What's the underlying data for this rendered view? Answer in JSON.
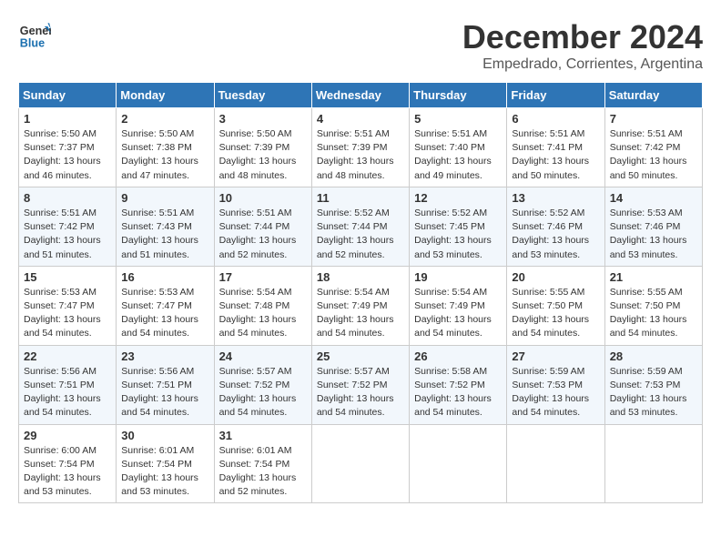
{
  "header": {
    "logo_line1": "General",
    "logo_line2": "Blue",
    "title": "December 2024",
    "subtitle": "Empedrado, Corrientes, Argentina"
  },
  "calendar": {
    "days_of_week": [
      "Sunday",
      "Monday",
      "Tuesday",
      "Wednesday",
      "Thursday",
      "Friday",
      "Saturday"
    ],
    "weeks": [
      [
        {
          "day": "",
          "detail": ""
        },
        {
          "day": "2",
          "detail": "Sunrise: 5:50 AM\nSunset: 7:38 PM\nDaylight: 13 hours\nand 47 minutes."
        },
        {
          "day": "3",
          "detail": "Sunrise: 5:50 AM\nSunset: 7:39 PM\nDaylight: 13 hours\nand 48 minutes."
        },
        {
          "day": "4",
          "detail": "Sunrise: 5:51 AM\nSunset: 7:39 PM\nDaylight: 13 hours\nand 48 minutes."
        },
        {
          "day": "5",
          "detail": "Sunrise: 5:51 AM\nSunset: 7:40 PM\nDaylight: 13 hours\nand 49 minutes."
        },
        {
          "day": "6",
          "detail": "Sunrise: 5:51 AM\nSunset: 7:41 PM\nDaylight: 13 hours\nand 50 minutes."
        },
        {
          "day": "7",
          "detail": "Sunrise: 5:51 AM\nSunset: 7:42 PM\nDaylight: 13 hours\nand 50 minutes."
        }
      ],
      [
        {
          "day": "1",
          "detail": "Sunrise: 5:50 AM\nSunset: 7:37 PM\nDaylight: 13 hours\nand 46 minutes."
        },
        {
          "day": "9",
          "detail": "Sunrise: 5:51 AM\nSunset: 7:43 PM\nDaylight: 13 hours\nand 51 minutes."
        },
        {
          "day": "10",
          "detail": "Sunrise: 5:51 AM\nSunset: 7:44 PM\nDaylight: 13 hours\nand 52 minutes."
        },
        {
          "day": "11",
          "detail": "Sunrise: 5:52 AM\nSunset: 7:44 PM\nDaylight: 13 hours\nand 52 minutes."
        },
        {
          "day": "12",
          "detail": "Sunrise: 5:52 AM\nSunset: 7:45 PM\nDaylight: 13 hours\nand 53 minutes."
        },
        {
          "day": "13",
          "detail": "Sunrise: 5:52 AM\nSunset: 7:46 PM\nDaylight: 13 hours\nand 53 minutes."
        },
        {
          "day": "14",
          "detail": "Sunrise: 5:53 AM\nSunset: 7:46 PM\nDaylight: 13 hours\nand 53 minutes."
        }
      ],
      [
        {
          "day": "8",
          "detail": "Sunrise: 5:51 AM\nSunset: 7:42 PM\nDaylight: 13 hours\nand 51 minutes."
        },
        {
          "day": "16",
          "detail": "Sunrise: 5:53 AM\nSunset: 7:47 PM\nDaylight: 13 hours\nand 54 minutes."
        },
        {
          "day": "17",
          "detail": "Sunrise: 5:54 AM\nSunset: 7:48 PM\nDaylight: 13 hours\nand 54 minutes."
        },
        {
          "day": "18",
          "detail": "Sunrise: 5:54 AM\nSunset: 7:49 PM\nDaylight: 13 hours\nand 54 minutes."
        },
        {
          "day": "19",
          "detail": "Sunrise: 5:54 AM\nSunset: 7:49 PM\nDaylight: 13 hours\nand 54 minutes."
        },
        {
          "day": "20",
          "detail": "Sunrise: 5:55 AM\nSunset: 7:50 PM\nDaylight: 13 hours\nand 54 minutes."
        },
        {
          "day": "21",
          "detail": "Sunrise: 5:55 AM\nSunset: 7:50 PM\nDaylight: 13 hours\nand 54 minutes."
        }
      ],
      [
        {
          "day": "15",
          "detail": "Sunrise: 5:53 AM\nSunset: 7:47 PM\nDaylight: 13 hours\nand 54 minutes."
        },
        {
          "day": "23",
          "detail": "Sunrise: 5:56 AM\nSunset: 7:51 PM\nDaylight: 13 hours\nand 54 minutes."
        },
        {
          "day": "24",
          "detail": "Sunrise: 5:57 AM\nSunset: 7:52 PM\nDaylight: 13 hours\nand 54 minutes."
        },
        {
          "day": "25",
          "detail": "Sunrise: 5:57 AM\nSunset: 7:52 PM\nDaylight: 13 hours\nand 54 minutes."
        },
        {
          "day": "26",
          "detail": "Sunrise: 5:58 AM\nSunset: 7:52 PM\nDaylight: 13 hours\nand 54 minutes."
        },
        {
          "day": "27",
          "detail": "Sunrise: 5:59 AM\nSunset: 7:53 PM\nDaylight: 13 hours\nand 54 minutes."
        },
        {
          "day": "28",
          "detail": "Sunrise: 5:59 AM\nSunset: 7:53 PM\nDaylight: 13 hours\nand 53 minutes."
        }
      ],
      [
        {
          "day": "22",
          "detail": "Sunrise: 5:56 AM\nSunset: 7:51 PM\nDaylight: 13 hours\nand 54 minutes."
        },
        {
          "day": "30",
          "detail": "Sunrise: 6:01 AM\nSunset: 7:54 PM\nDaylight: 13 hours\nand 53 minutes."
        },
        {
          "day": "31",
          "detail": "Sunrise: 6:01 AM\nSunset: 7:54 PM\nDaylight: 13 hours\nand 52 minutes."
        },
        {
          "day": "",
          "detail": ""
        },
        {
          "day": "",
          "detail": ""
        },
        {
          "day": "",
          "detail": ""
        },
        {
          "day": "",
          "detail": ""
        }
      ],
      [
        {
          "day": "29",
          "detail": "Sunrise: 6:00 AM\nSunset: 7:54 PM\nDaylight: 13 hours\nand 53 minutes."
        },
        {
          "day": "",
          "detail": ""
        },
        {
          "day": "",
          "detail": ""
        },
        {
          "day": "",
          "detail": ""
        },
        {
          "day": "",
          "detail": ""
        },
        {
          "day": "",
          "detail": ""
        },
        {
          "day": "",
          "detail": ""
        }
      ]
    ]
  }
}
